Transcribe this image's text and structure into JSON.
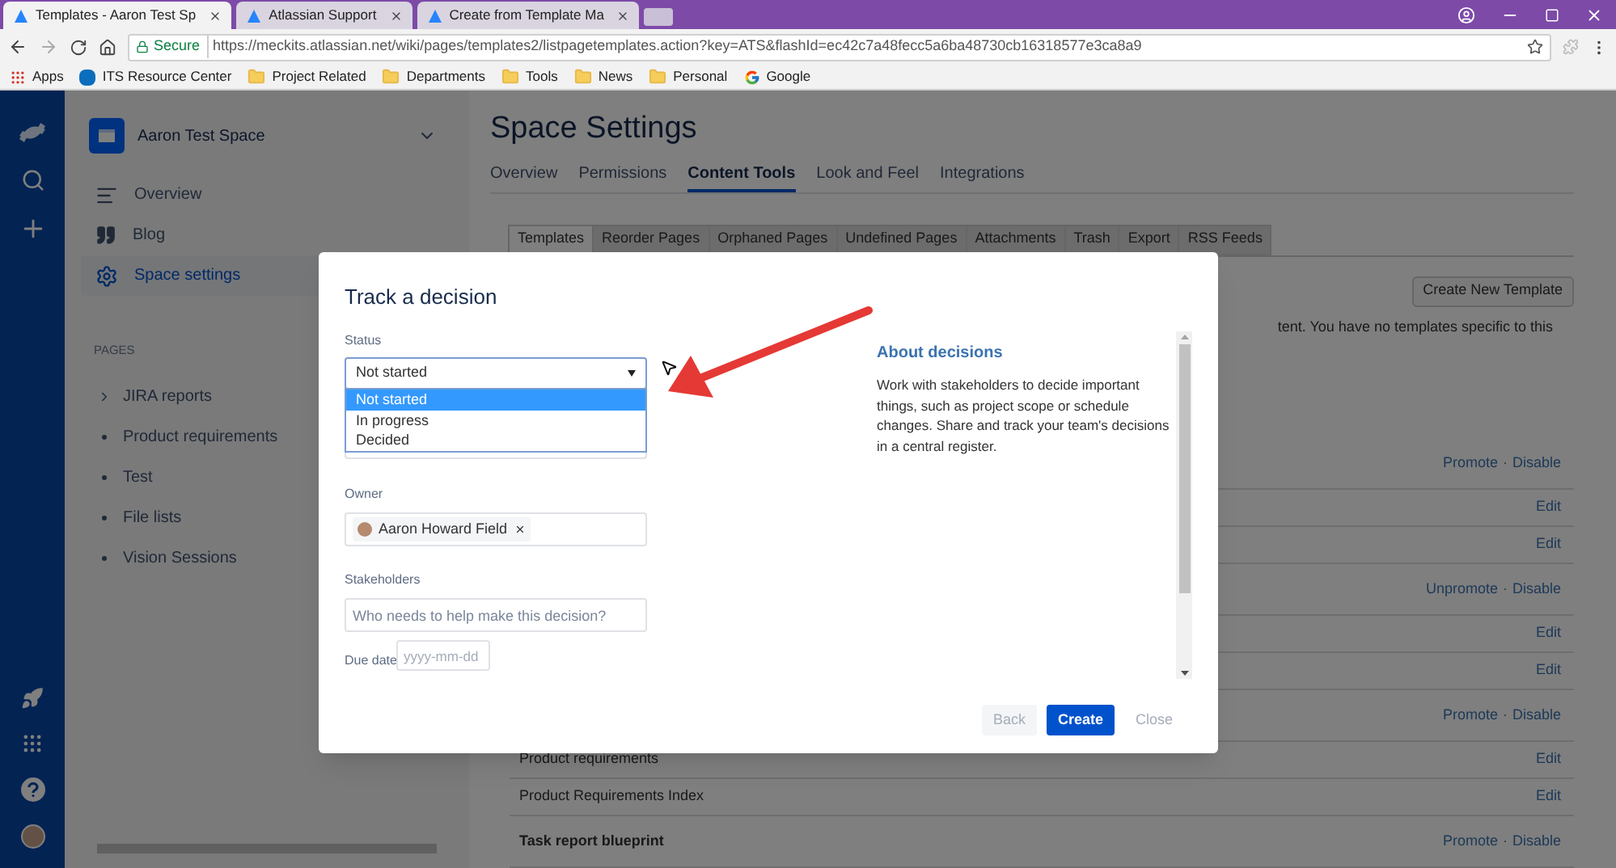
{
  "browser": {
    "tabs": [
      {
        "title": "Templates - Aaron Test Sp",
        "selected": true
      },
      {
        "title": "Atlassian Support",
        "selected": false
      },
      {
        "title": "Create from Template Ma",
        "selected": false
      }
    ],
    "secure_label": "Secure",
    "url": "https://meckits.atlassian.net/wiki/pages/templates2/listpagetemplates.action?key=ATS&flashId=ec42c7a48fecc5a6ba48730cb16318577e3ca8a9",
    "bookmarks": [
      {
        "label": "Apps",
        "kind": "apps"
      },
      {
        "label": "ITS Resource Center",
        "kind": "site"
      },
      {
        "label": "Project Related",
        "kind": "folder"
      },
      {
        "label": "Departments",
        "kind": "folder"
      },
      {
        "label": "Tools",
        "kind": "folder"
      },
      {
        "label": "News",
        "kind": "folder"
      },
      {
        "label": "Personal",
        "kind": "folder"
      },
      {
        "label": "Google",
        "kind": "google"
      }
    ]
  },
  "sidebar": {
    "space_name": "Aaron Test Space",
    "nav": [
      {
        "label": "Overview",
        "selected": false
      },
      {
        "label": "Blog",
        "selected": false
      },
      {
        "label": "Space settings",
        "selected": true
      }
    ],
    "pages_heading": "PAGES",
    "pages": [
      {
        "label": "JIRA reports",
        "kind": "parent",
        "expanded": false
      },
      {
        "label": "Product requirements",
        "kind": "leaf"
      },
      {
        "label": "Test",
        "kind": "leaf"
      },
      {
        "label": "File lists",
        "kind": "leaf"
      },
      {
        "label": "Vision Sessions",
        "kind": "leaf"
      }
    ]
  },
  "main": {
    "title": "Space Settings",
    "tabs": [
      {
        "label": "Overview",
        "selected": false
      },
      {
        "label": "Permissions",
        "selected": false
      },
      {
        "label": "Content Tools",
        "selected": true
      },
      {
        "label": "Look and Feel",
        "selected": false
      },
      {
        "label": "Integrations",
        "selected": false
      }
    ],
    "sub_tabs": [
      {
        "label": "Templates",
        "selected": true
      },
      {
        "label": "Reorder Pages",
        "selected": false
      },
      {
        "label": "Orphaned Pages",
        "selected": false
      },
      {
        "label": "Undefined Pages",
        "selected": false
      },
      {
        "label": "Attachments",
        "selected": false
      },
      {
        "label": "Trash",
        "selected": false
      },
      {
        "label": "Export",
        "selected": false
      },
      {
        "label": "RSS Feeds",
        "selected": false
      }
    ],
    "create_button": "Create New Template",
    "intro_text": "tent. You have no templates specific to this",
    "link_separator": "·",
    "rows": [
      {
        "kind": "group",
        "links": [
          "Promote",
          "Disable"
        ]
      },
      {
        "kind": "item",
        "links": [
          "Edit"
        ]
      },
      {
        "kind": "item",
        "links": [
          "Edit"
        ]
      },
      {
        "kind": "group",
        "links": [
          "Unpromote",
          "Disable"
        ]
      },
      {
        "kind": "item",
        "links": [
          "Edit"
        ]
      },
      {
        "kind": "item",
        "links": [
          "Edit"
        ]
      },
      {
        "kind": "group",
        "links": [
          "Promote",
          "Disable"
        ]
      },
      {
        "kind": "item",
        "label": "Product requirements",
        "links": [
          "Edit"
        ]
      },
      {
        "kind": "item",
        "label": "Product Requirements Index",
        "links": [
          "Edit"
        ]
      },
      {
        "kind": "group",
        "label": "Task report blueprint",
        "links": [
          "Promote",
          "Disable"
        ]
      }
    ]
  },
  "dialog": {
    "title": "Track a decision",
    "status": {
      "label": "Status",
      "value": "Not started",
      "options": [
        {
          "label": "Not started",
          "selected": true
        },
        {
          "label": "In progress",
          "selected": false
        },
        {
          "label": "Decided",
          "selected": false
        }
      ]
    },
    "owner": {
      "label": "Owner",
      "value": "Aaron Howard Field"
    },
    "stakeholders": {
      "label": "Stakeholders",
      "placeholder": "Who needs to help make this decision?"
    },
    "due_date": {
      "label": "Due date",
      "placeholder": "yyyy-mm-dd"
    },
    "about": {
      "title": "About decisions",
      "text": "Work with stakeholders to decide important things, such as project scope or schedule changes. Share and track your team's decisions in a central register."
    },
    "buttons": [
      {
        "label": "Back",
        "kind": "secondary"
      },
      {
        "label": "Create",
        "kind": "primary"
      },
      {
        "label": "Close",
        "kind": "link"
      }
    ]
  }
}
